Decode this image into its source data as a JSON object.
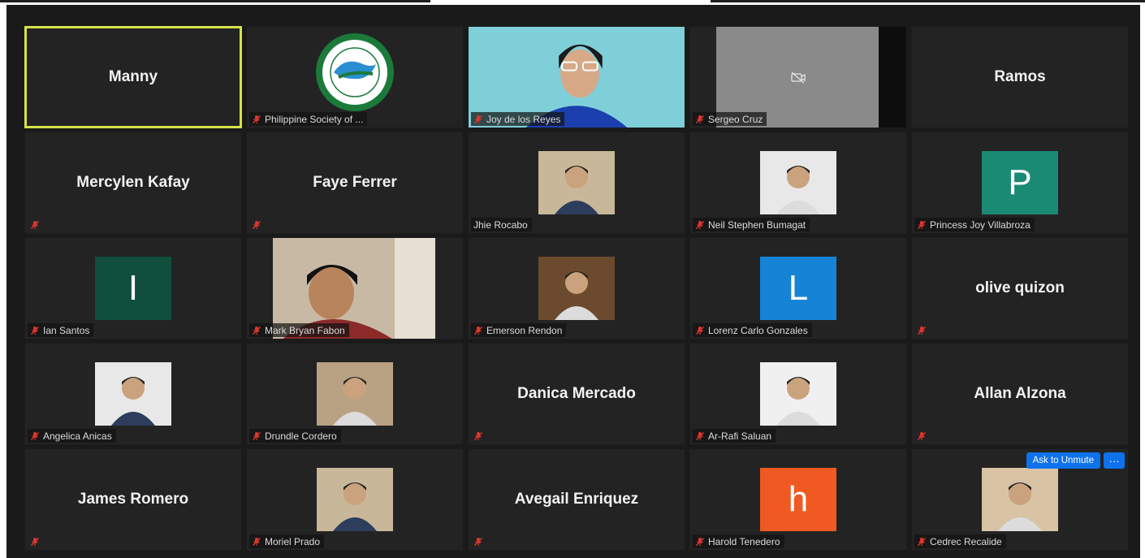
{
  "meeting": {
    "participants": [
      {
        "name": "Manny",
        "display": "name",
        "active": true,
        "show_label": false
      },
      {
        "name": "Philippine Society of ...",
        "display": "logo"
      },
      {
        "name": "Joy de los Reyes",
        "display": "video"
      },
      {
        "name": "Sergeo Cruz",
        "display": "camera-off"
      },
      {
        "name": "Ramos",
        "display": "name",
        "show_label": false
      },
      {
        "name": "Mercylen Kafay",
        "display": "name",
        "label_icon_only": true
      },
      {
        "name": "Faye Ferrer",
        "display": "name",
        "label_icon_only": true
      },
      {
        "name": "Jhie Rocabo",
        "display": "photo",
        "label_no_mic": true
      },
      {
        "name": "Neil Stephen Bumagat",
        "display": "photo"
      },
      {
        "name": "Princess Joy Villabroza",
        "display": "avatar",
        "initial": "P",
        "color": "#1b8a74"
      },
      {
        "name": "Ian Santos",
        "display": "avatar",
        "initial": "I",
        "color": "#0f4f3b"
      },
      {
        "name": "Mark Bryan Fabon",
        "display": "video-wide"
      },
      {
        "name": "Emerson Rendon",
        "display": "photo"
      },
      {
        "name": "Lorenz Carlo Gonzales",
        "display": "avatar",
        "initial": "L",
        "color": "#1584d6"
      },
      {
        "name": "olive quizon",
        "display": "name",
        "label_icon_only": true
      },
      {
        "name": "Angelica Anicas",
        "display": "photo"
      },
      {
        "name": "Drundle Cordero",
        "display": "photo"
      },
      {
        "name": "Danica Mercado",
        "display": "name",
        "label_icon_only": true
      },
      {
        "name": "Ar-Rafi Saluan",
        "display": "photo"
      },
      {
        "name": "Allan Alzona",
        "display": "name",
        "label_icon_only": true
      },
      {
        "name": "James Romero",
        "display": "name",
        "label_icon_only": true
      },
      {
        "name": "Moriel Prado",
        "display": "photo"
      },
      {
        "name": "Avegail Enriquez",
        "display": "name",
        "label_icon_only": true
      },
      {
        "name": "Harold Tenedero",
        "display": "avatar",
        "initial": "h",
        "color": "#ee5a22"
      },
      {
        "name": "Cedrec Recalide",
        "display": "photo",
        "hover": true
      }
    ],
    "hover_actions": {
      "ask_to_unmute_label": "Ask to Unmute",
      "more_label": "···"
    },
    "colors": {
      "active_speaker": "#d6e34a",
      "muted_mic": "#e0362c",
      "button_blue": "#0e72ed"
    }
  }
}
